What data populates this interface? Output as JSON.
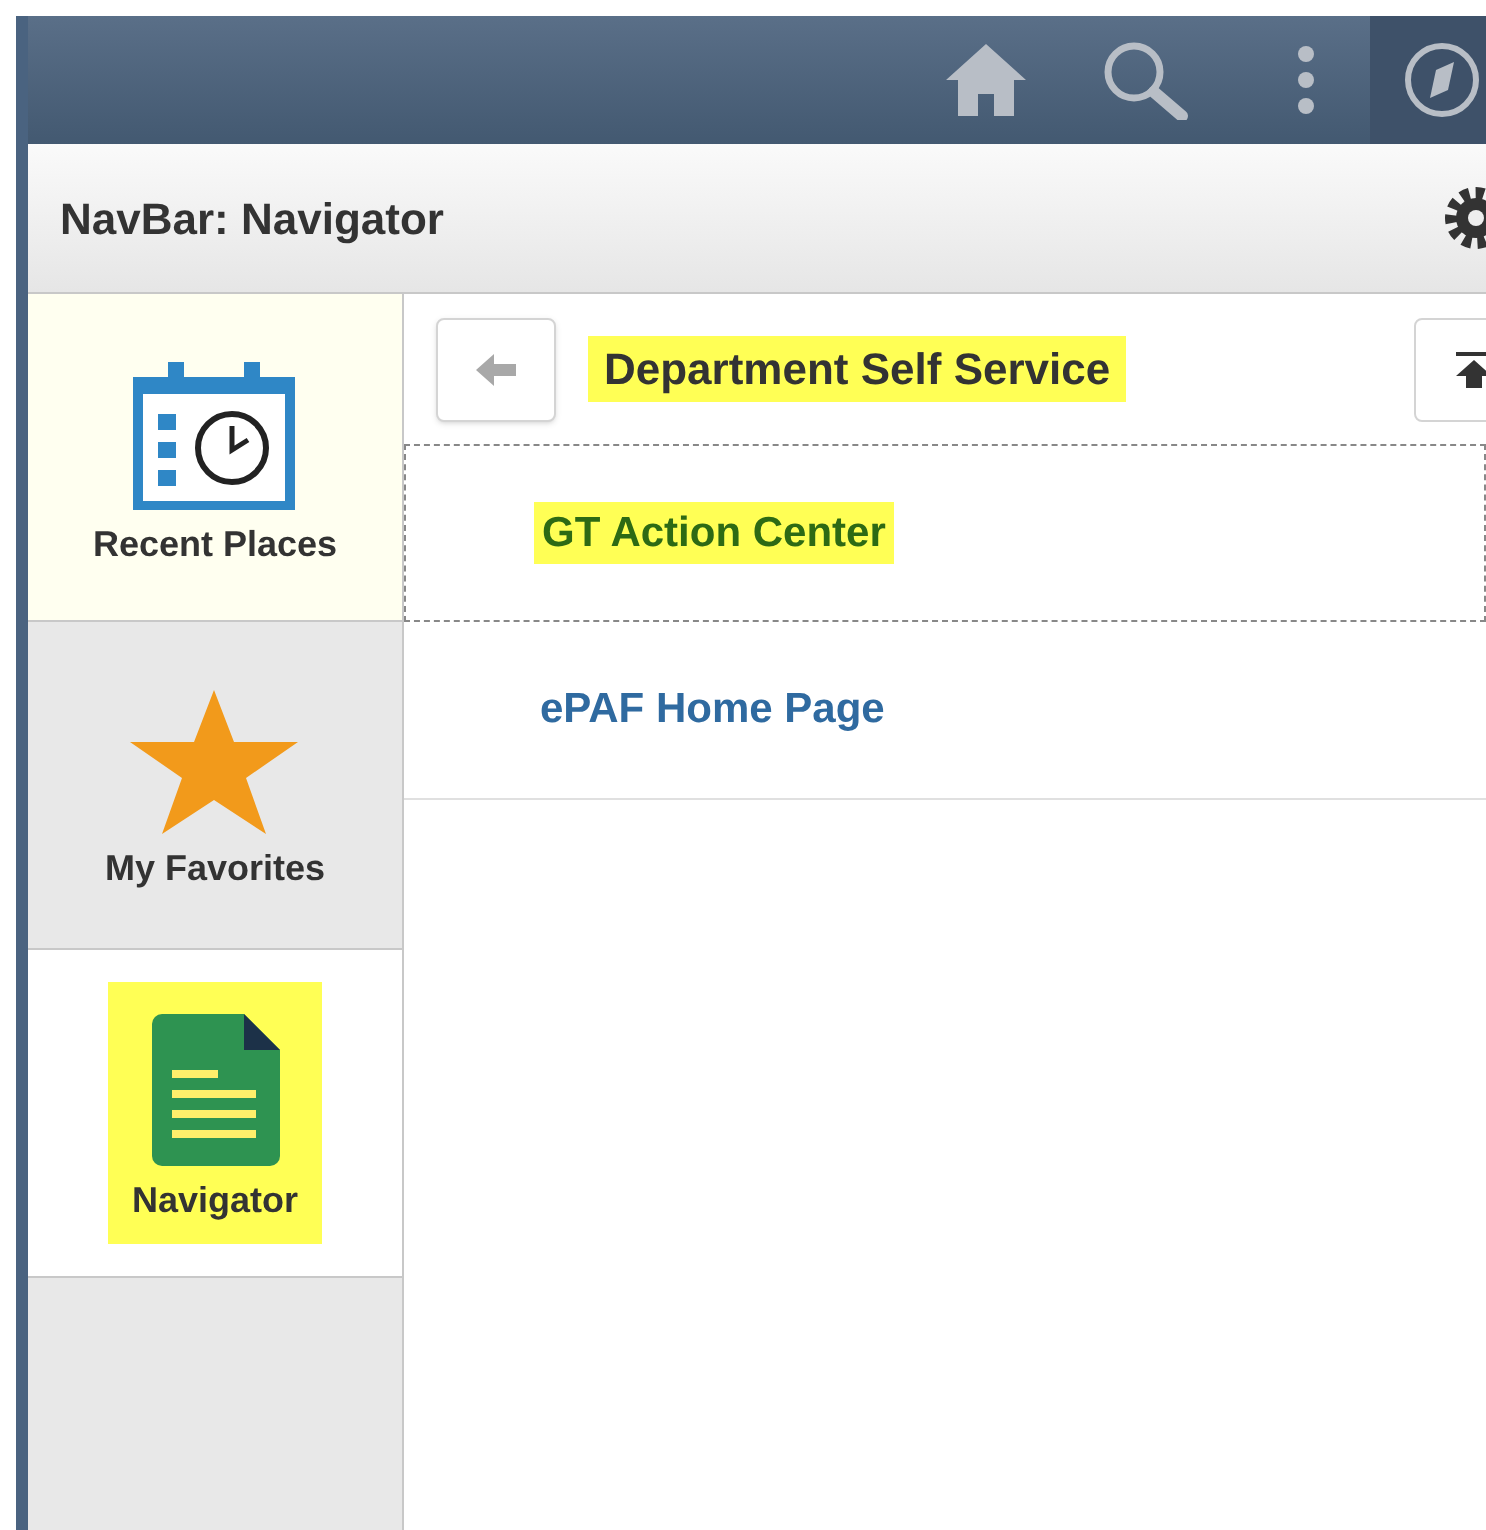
{
  "top_bar": {
    "navbar_open": true
  },
  "panel": {
    "title": "NavBar: Navigator"
  },
  "sidebar": {
    "items": [
      {
        "label": "Recent Places",
        "kind": "calendar",
        "selected": false,
        "hovered": true,
        "highlighted": false
      },
      {
        "label": "My Favorites",
        "kind": "star",
        "selected": false,
        "hovered": false,
        "highlighted": false
      },
      {
        "label": "Navigator",
        "kind": "document",
        "selected": true,
        "hovered": false,
        "highlighted": true
      }
    ]
  },
  "breadcrumb": {
    "title": "Department Self Service",
    "highlighted": true
  },
  "list": {
    "items": [
      {
        "label": "GT Action Center",
        "highlighted": true,
        "focused": true,
        "visited": true
      },
      {
        "label": "ePAF Home Page",
        "highlighted": false,
        "focused": false,
        "visited": false
      }
    ]
  }
}
